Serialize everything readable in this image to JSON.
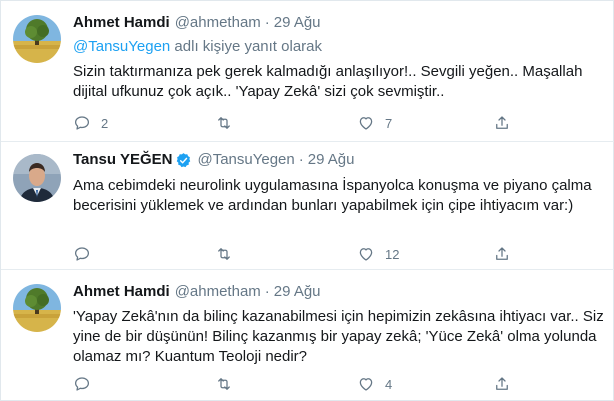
{
  "tweets": [
    {
      "name": "Ahmet Hamdi",
      "handle": "@ahmetham",
      "separator": "·",
      "date": "29 Ağu",
      "replying_mention": "@TansuYegen",
      "replying_suffix": " adlı kişiye yanıt olarak",
      "text": "Sizin taktırmanıza pek gerek kalmadığı anlaşılıyor!.. Sevgili yeğen.. Maşallah dijital ufkunuz çok açık.. 'Yapay Zekâ' sizi çok sevmiştir..",
      "reply_count": "2",
      "retweet_count": "",
      "like_count": "7"
    },
    {
      "name": "Tansu YEĞEN",
      "handle": "@TansuYegen",
      "separator": "·",
      "date": "29 Ağu",
      "verified": true,
      "text": "Ama cebimdeki neurolink uygulamasına İspanyolca konuşma ve piyano çalma becerisini yüklemek ve ardından bunları yapabilmek için çipe ihtiyacım var:)",
      "reply_count": "",
      "retweet_count": "",
      "like_count": "12"
    },
    {
      "name": "Ahmet Hamdi",
      "handle": "@ahmetham",
      "separator": "·",
      "date": "29 Ağu",
      "text": "'Yapay Zekâ'nın da bilinç kazanabilmesi için hepimizin zekâsına ihtiyacı var.. Siz yine de bir düşünün! Bilinç kazanmış bir yapay zekâ; 'Yüce Zekâ' olma yolunda olamaz mı? Kuantum Teoloji nedir?",
      "reply_count": "",
      "retweet_count": "",
      "like_count": "4"
    }
  ],
  "colors": {
    "accent": "#1da1f2",
    "muted": "#657786",
    "text": "#14171a",
    "border": "#e6ecf0"
  },
  "icons": {
    "reply": "reply-icon",
    "retweet": "retweet-icon",
    "like": "like-icon",
    "share": "share-icon",
    "verified": "verified-badge-icon"
  }
}
